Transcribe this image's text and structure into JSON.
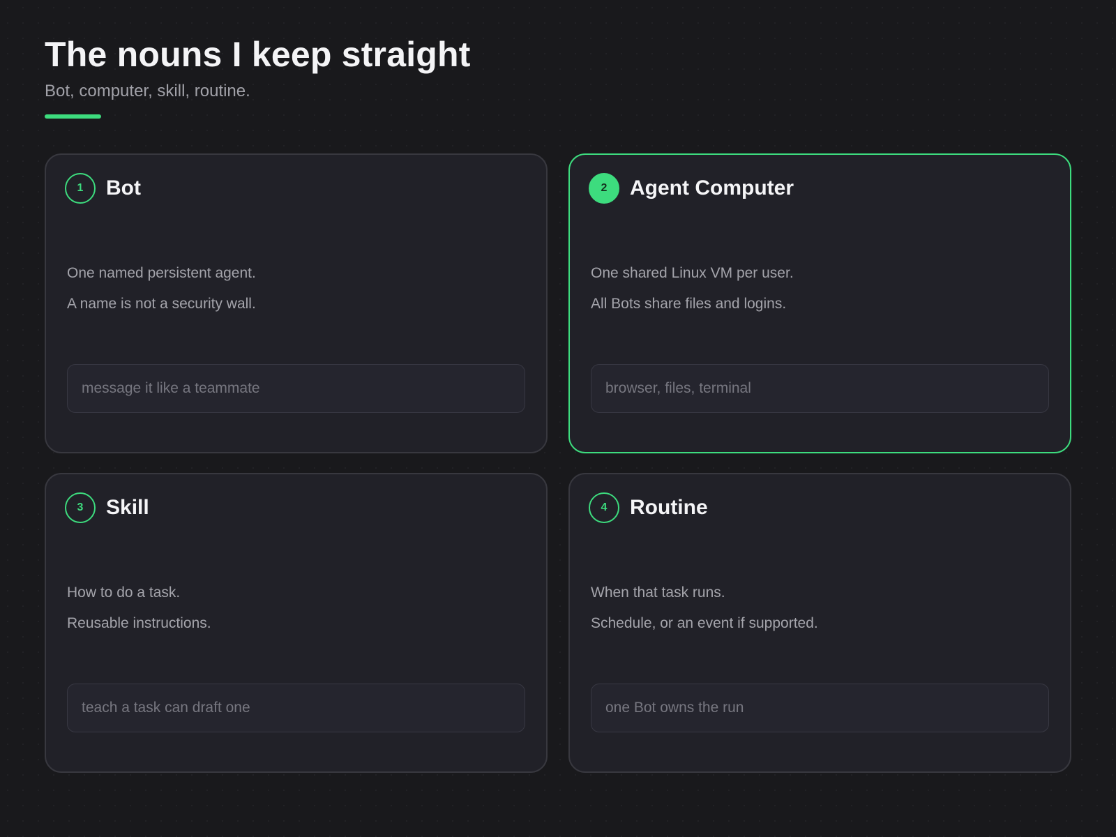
{
  "header": {
    "title": "The nouns I keep straight",
    "subtitle": "Bot, computer, skill, routine."
  },
  "colors": {
    "accent": "#3ddc7e",
    "background": "#19191c",
    "card": "#212128"
  },
  "cards": [
    {
      "number": "1",
      "title": "Bot",
      "lines": [
        "One named persistent agent.",
        "A name is not a security wall."
      ],
      "field": "message it like a teammate",
      "active": false
    },
    {
      "number": "2",
      "title": "Agent Computer",
      "lines": [
        "One shared Linux VM per user.",
        "All Bots share files and logins."
      ],
      "field": "browser, files, terminal",
      "active": true
    },
    {
      "number": "3",
      "title": "Skill",
      "lines": [
        "How to do a task.",
        "Reusable instructions."
      ],
      "field": "teach a task can draft one",
      "active": false
    },
    {
      "number": "4",
      "title": "Routine",
      "lines": [
        "When that task runs.",
        "Schedule, or an event if supported."
      ],
      "field": "one Bot owns the run",
      "active": false
    }
  ]
}
